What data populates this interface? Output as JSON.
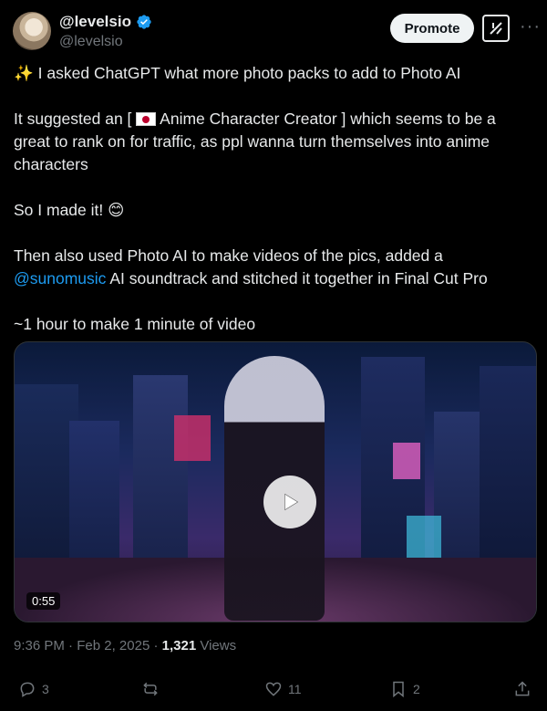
{
  "author": {
    "name": "@levelsio",
    "handle": "@levelsio"
  },
  "header": {
    "promote_label": "Promote",
    "more_label": "···"
  },
  "post": {
    "line1": " I asked ChatGPT what more photo packs to add to Photo AI",
    "line2_a": "It suggested an [ ",
    "line2_b": " Anime Character Creator ] which seems to be a great to rank on for traffic, as ppl wanna turn themselves into anime characters",
    "line3": "So I made it! ",
    "line4_a": "Then also used Photo AI to make videos of the pics, added a ",
    "mention": "@sunomusic",
    "line4_b": " AI soundtrack and stitched it together in Final Cut Pro",
    "line5": "~1 hour to make 1 minute of video"
  },
  "media": {
    "duration": "0:55"
  },
  "meta": {
    "time": "9:36 PM",
    "date": "Feb 2, 2025",
    "views_count": "1,321",
    "views_label": "Views"
  },
  "actions": {
    "replies": "3",
    "reposts": "",
    "likes": "11",
    "bookmarks": "2"
  },
  "colors": {
    "accent": "#1d9bf0",
    "background": "#000000"
  }
}
